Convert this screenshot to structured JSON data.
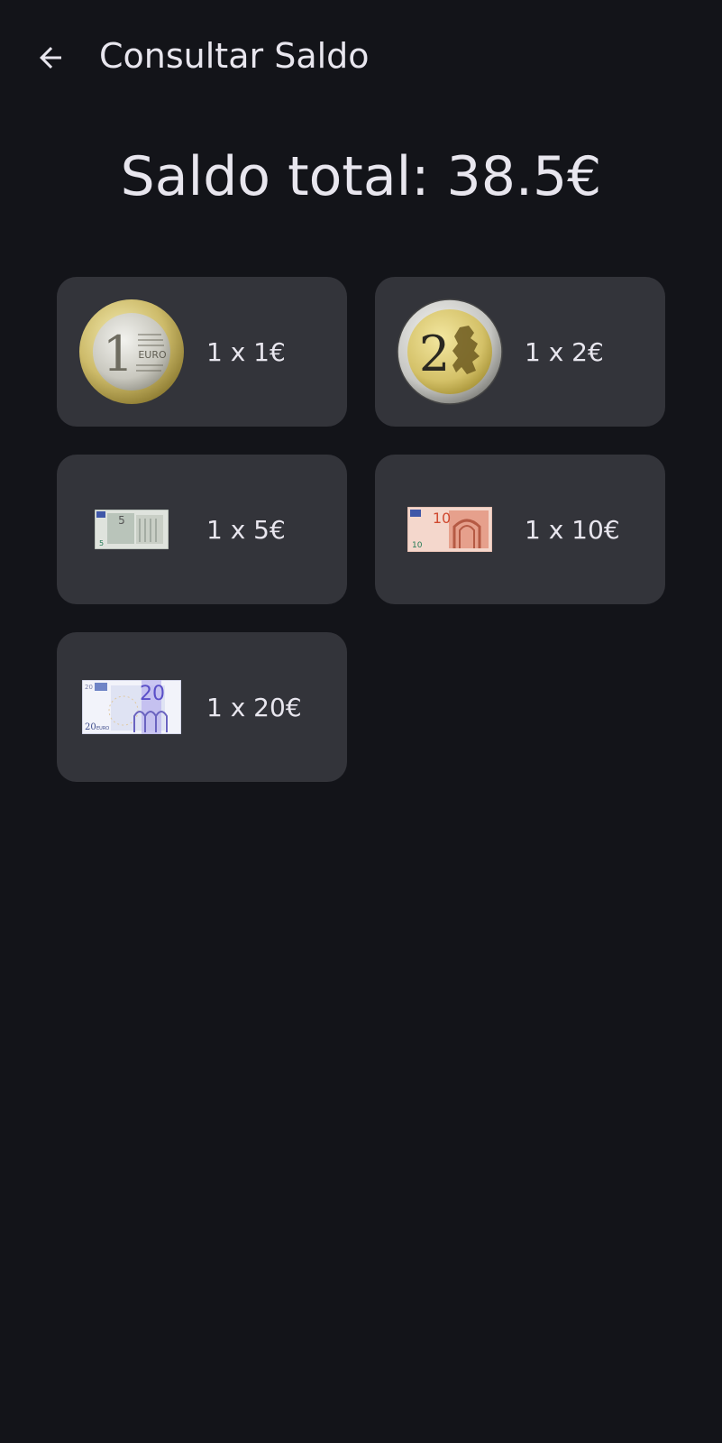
{
  "app_bar": {
    "title": "Consultar Saldo",
    "back_icon": "arrow-left-icon"
  },
  "balance": {
    "text": "Saldo total: 38.5€"
  },
  "items": [
    {
      "label": "1 x 1€",
      "kind": "coin-1-euro",
      "printed": "1",
      "printed_euro": "EURO"
    },
    {
      "label": "1 x 2€",
      "kind": "coin-2-euro",
      "printed": "2"
    },
    {
      "label": "1 x 5€",
      "kind": "note-5-euro",
      "printed": "5"
    },
    {
      "label": "1 x 10€",
      "kind": "note-10-euro",
      "printed": "10"
    },
    {
      "label": "1 x 20€",
      "kind": "note-20-euro",
      "printed": "20",
      "printed_euro": "EURO"
    }
  ],
  "colors": {
    "background": "#131419",
    "card": "#33343a",
    "text": "#e8e6ee"
  }
}
